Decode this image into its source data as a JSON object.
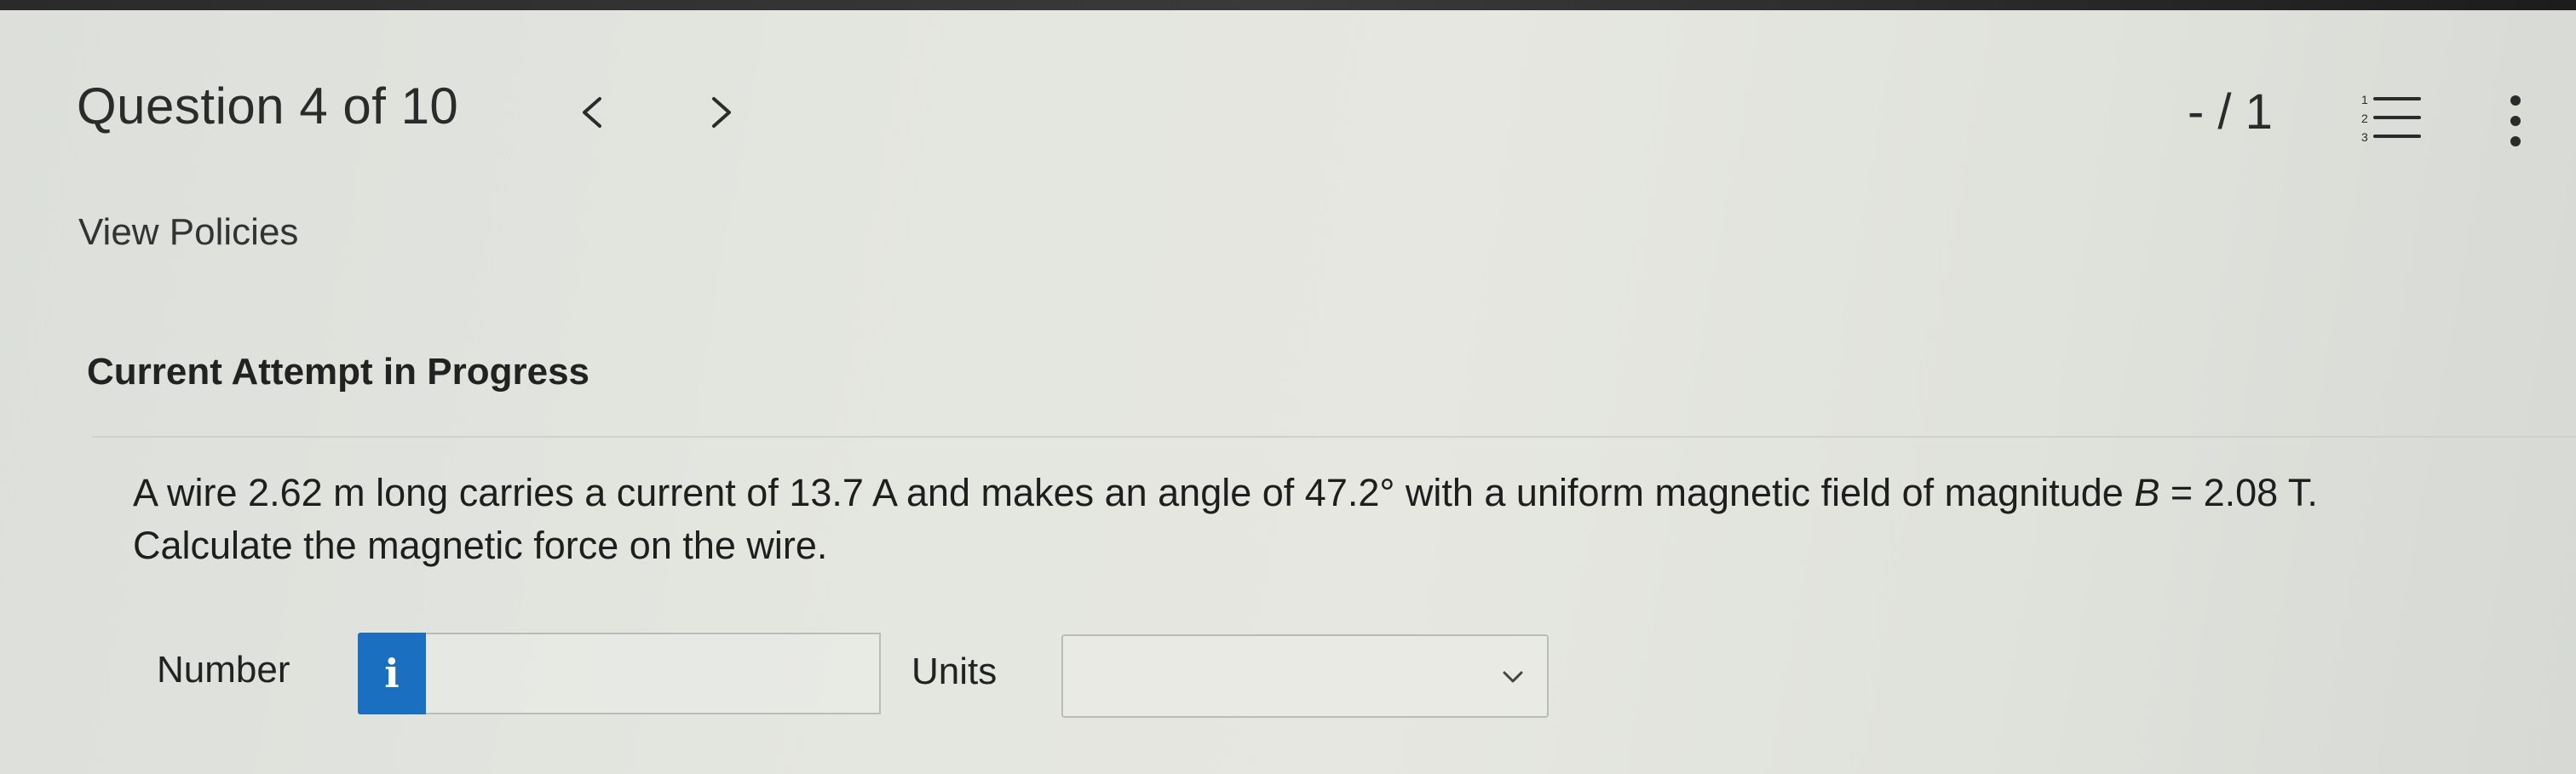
{
  "header": {
    "question_title": "Question 4 of 10",
    "prev_label": "<",
    "next_label": ">",
    "score": "- / 1"
  },
  "links": {
    "view_policies": "View Policies"
  },
  "attempt": {
    "status": "Current Attempt in Progress"
  },
  "question": {
    "line1_part1": "A wire 2.62 m long carries a current of 13.7 A and makes an angle of 47.2° with a uniform magnetic field of magnitude ",
    "line1_var": "B",
    "line1_part2": " = 2.08 T.",
    "line2": "Calculate the magnetic force on the wire."
  },
  "answer": {
    "number_label": "Number",
    "info_symbol": "i",
    "number_value": "",
    "units_label": "Units",
    "units_value": ""
  },
  "colors": {
    "info_badge": "#1a6fc0",
    "background": "#e3e5df"
  },
  "icons": {
    "prev": "chevron-left-icon",
    "next": "chevron-right-icon",
    "list": "numbered-list-icon",
    "more": "more-vertical-icon",
    "dropdown": "chevron-down-icon"
  }
}
